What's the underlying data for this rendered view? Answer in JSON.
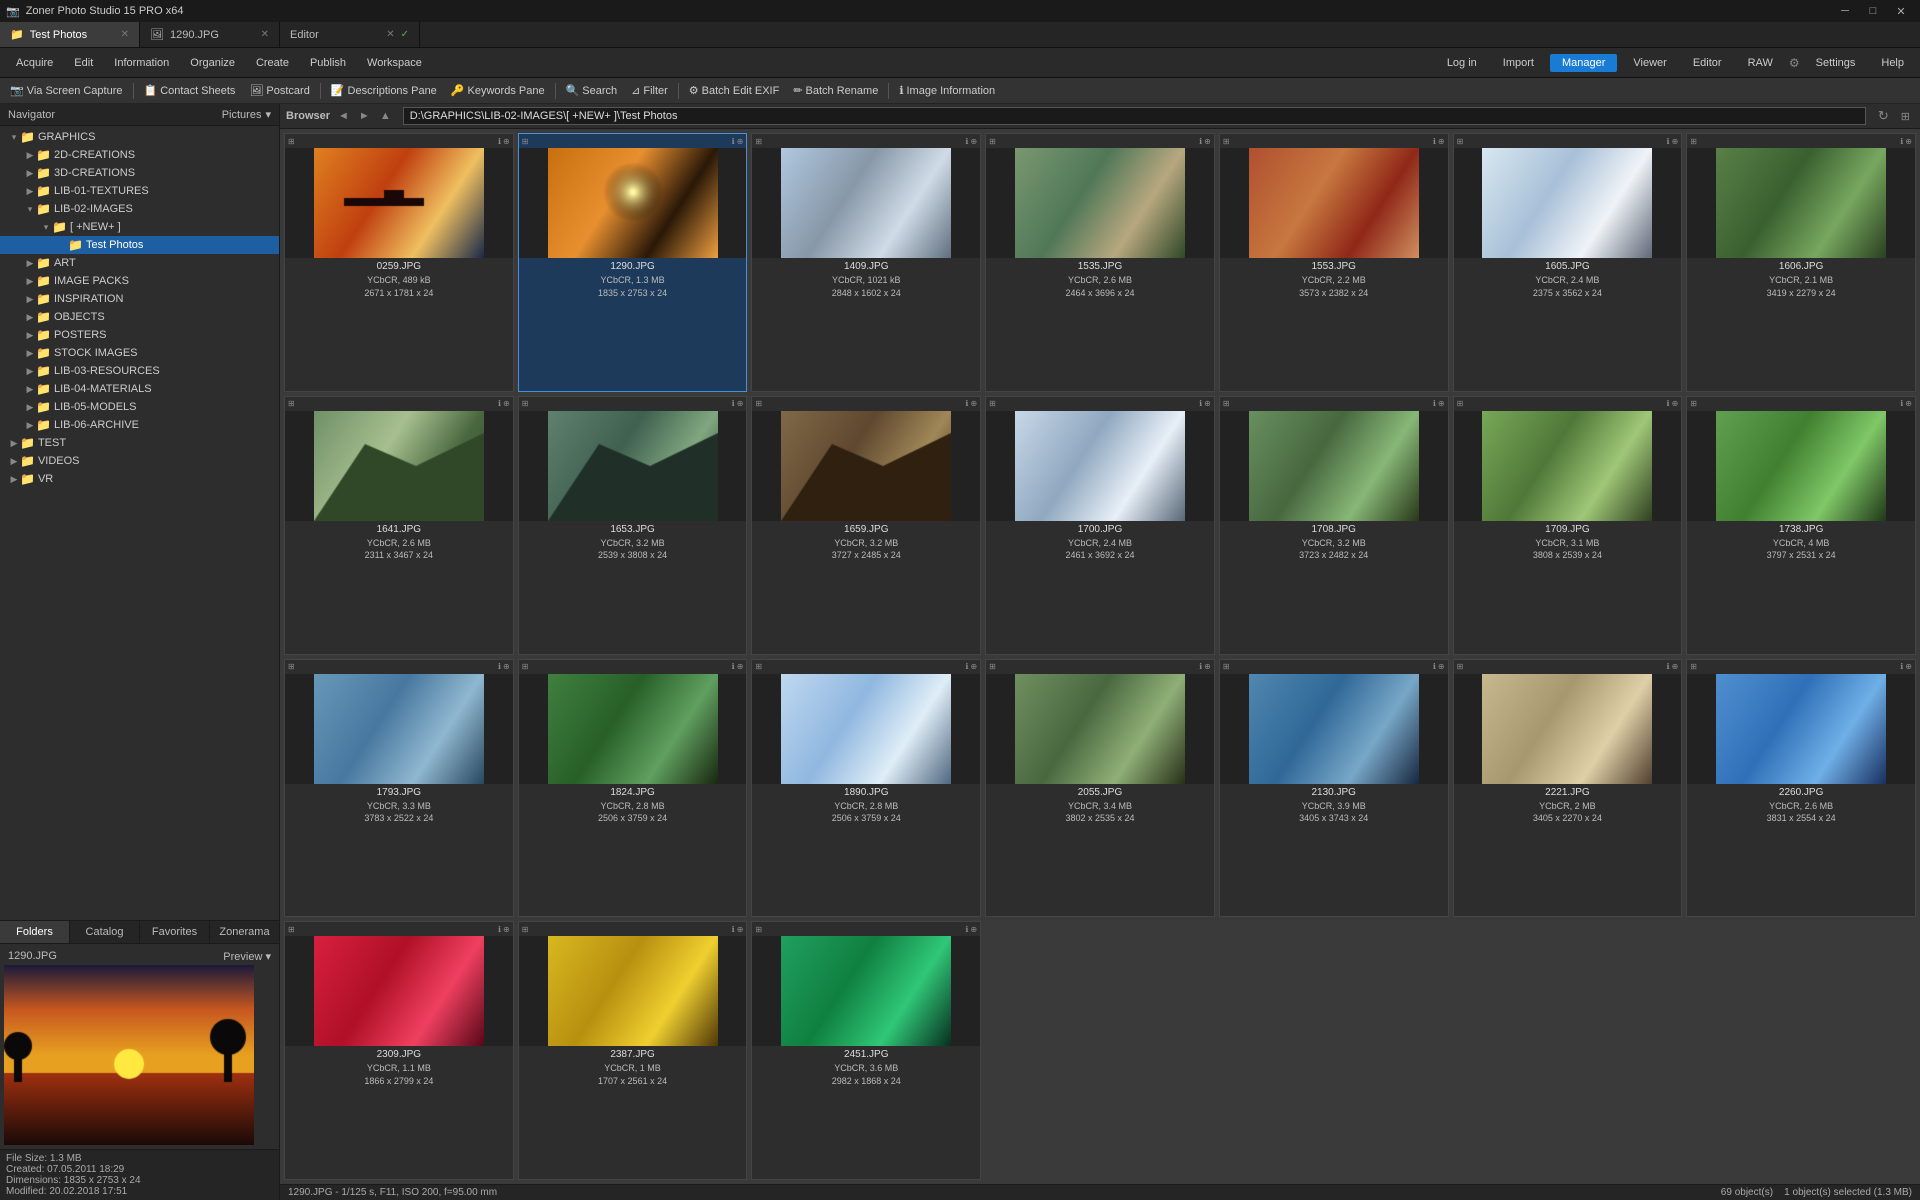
{
  "app": {
    "title": "Zoner Photo Studio 15 PRO x64",
    "icon": "📷"
  },
  "titlebar": {
    "title": "Zoner Photo Studio 15 PRO x64",
    "min": "─",
    "max": "□",
    "close": "✕"
  },
  "tabs": [
    {
      "id": "test-photos",
      "label": "Test Photos",
      "active": true,
      "closable": true
    },
    {
      "id": "1290jpg",
      "label": "1290.JPG",
      "active": false,
      "closable": true
    },
    {
      "id": "editor",
      "label": "Editor",
      "active": false,
      "closable": true
    }
  ],
  "topnav": {
    "items": [
      "Acquire",
      "Edit",
      "Information",
      "Organize",
      "Create",
      "Publish",
      "Workspace"
    ],
    "right": [
      "Log in",
      "Import",
      "Manager",
      "Viewer",
      "Editor",
      "RAW"
    ]
  },
  "toolbar": {
    "items": [
      "Via Screen Capture",
      "Contact Sheets",
      "Postcard",
      "Descriptions Pane",
      "Keywords Pane",
      "Search",
      "Filter",
      "Batch Edit EXIF",
      "Batch Rename",
      "Image Information"
    ]
  },
  "sidebar": {
    "header": {
      "left": "Navigator",
      "right": "Pictures"
    },
    "tree": [
      {
        "level": 0,
        "label": "GRAPHICS",
        "type": "folder",
        "open": true
      },
      {
        "level": 1,
        "label": "2D-CREATIONS",
        "type": "folder",
        "open": false
      },
      {
        "level": 1,
        "label": "3D-CREATIONS",
        "type": "folder",
        "open": false
      },
      {
        "level": 1,
        "label": "LIB-01-TEXTURES",
        "type": "folder",
        "open": false
      },
      {
        "level": 1,
        "label": "LIB-02-IMAGES",
        "type": "folder",
        "open": true
      },
      {
        "level": 2,
        "label": "[ +NEW+ ]",
        "type": "folder",
        "open": true
      },
      {
        "level": 3,
        "label": "Test Photos",
        "type": "folder",
        "open": false,
        "selected": true
      },
      {
        "level": 1,
        "label": "ART",
        "type": "folder",
        "open": false
      },
      {
        "level": 1,
        "label": "IMAGE PACKS",
        "type": "folder",
        "open": false
      },
      {
        "level": 1,
        "label": "INSPIRATION",
        "type": "folder",
        "open": false
      },
      {
        "level": 1,
        "label": "OBJECTS",
        "type": "folder",
        "open": false
      },
      {
        "level": 1,
        "label": "POSTERS",
        "type": "folder",
        "open": false
      },
      {
        "level": 1,
        "label": "STOCK IMAGES",
        "type": "folder",
        "open": false
      },
      {
        "level": 1,
        "label": "LIB-03-RESOURCES",
        "type": "folder",
        "open": false
      },
      {
        "level": 1,
        "label": "LIB-04-MATERIALS",
        "type": "folder",
        "open": false
      },
      {
        "level": 1,
        "label": "LIB-05-MODELS",
        "type": "folder",
        "open": false
      },
      {
        "level": 1,
        "label": "LIB-06-ARCHIVE",
        "type": "folder",
        "open": false
      },
      {
        "level": 0,
        "label": "TEST",
        "type": "folder",
        "open": false
      },
      {
        "level": 0,
        "label": "VIDEOS",
        "type": "folder",
        "open": false
      },
      {
        "level": 0,
        "label": "VR",
        "type": "folder",
        "open": false
      }
    ],
    "tabs": [
      "Folders",
      "Catalog",
      "Favorites",
      "Zonerama"
    ],
    "active_tab": "Folders",
    "preview": {
      "filename": "1290.JPG",
      "label": "Preview"
    }
  },
  "browser": {
    "label": "Browser",
    "path": "D:\\GRAPHICS\\LIB-02-IMAGES\\[ +NEW+ ]\\Test Photos",
    "thumbnails": [
      {
        "filename": "0259.JPG",
        "colorspace": "YCbCR",
        "size": "489 kB",
        "dims": "2671 x 1781 x 24",
        "selected": false,
        "color": "#c4621a"
      },
      {
        "filename": "1290.JPG",
        "colorspace": "YCbCR",
        "size": "1.3 MB",
        "dims": "1835 x 2753 x 24",
        "selected": true,
        "color": "#e8a020"
      },
      {
        "filename": "1409.JPG",
        "colorspace": "YCbCR",
        "size": "1021 kB",
        "dims": "2848 x 1602 x 24",
        "selected": false,
        "color": "#8ab0cc"
      },
      {
        "filename": "1535.JPG",
        "colorspace": "YCbCR",
        "size": "2.6 MB",
        "dims": "2464 x 3696 x 24",
        "selected": false,
        "color": "#7a9060"
      },
      {
        "filename": "1553.JPG",
        "colorspace": "YCbCR",
        "size": "2.2 MB",
        "dims": "3573 x 2382 x 24",
        "selected": false,
        "color": "#b05830"
      },
      {
        "filename": "1605.JPG",
        "colorspace": "YCbCR",
        "size": "2.4 MB",
        "dims": "2375 x 3562 x 24",
        "selected": false,
        "color": "#d0d8e0"
      },
      {
        "filename": "1606.JPG",
        "colorspace": "YCbCR",
        "size": "2.1 MB",
        "dims": "3419 x 2279 x 24",
        "selected": false,
        "color": "#6888a0"
      },
      {
        "filename": "1641.JPG",
        "colorspace": "YCbCR",
        "size": "2.6 MB",
        "dims": "2311 x 3467 x 24",
        "selected": false,
        "color": "#5a7050"
      },
      {
        "filename": "1653.JPG",
        "colorspace": "YCbCR",
        "size": "3.2 MB",
        "dims": "2539 x 3808 x 24",
        "selected": false,
        "color": "#708860"
      },
      {
        "filename": "1659.JPG",
        "colorspace": "YCbCR",
        "size": "3.2 MB",
        "dims": "3727 x 2485 x 24",
        "selected": false,
        "color": "#607868"
      },
      {
        "filename": "1700.JPG",
        "colorspace": "YCbCR",
        "size": "2.4 MB",
        "dims": "2461 x 3692 x 24",
        "selected": false,
        "color": "#9ab0c0"
      },
      {
        "filename": "1708.JPG",
        "colorspace": "YCbCR",
        "size": "3.2 MB",
        "dims": "3723 x 2482 x 24",
        "selected": false,
        "color": "#88a070"
      },
      {
        "filename": "1709.JPG",
        "colorspace": "YCbCR",
        "size": "3.1 MB",
        "dims": "3808 x 2539 x 24",
        "selected": false,
        "color": "#78a858"
      },
      {
        "filename": "1738.JPG",
        "colorspace": "YCbCR",
        "size": "4 MB",
        "dims": "3797 x 2531 x 24",
        "selected": false,
        "color": "#60a060"
      },
      {
        "filename": "1793.JPG",
        "colorspace": "YCbCR",
        "size": "3.3 MB",
        "dims": "3783 x 2522 x 24",
        "selected": false,
        "color": "#7898b0"
      },
      {
        "filename": "1824.JPG",
        "colorspace": "YCbCR",
        "size": "2.8 MB",
        "dims": "2506 x 3759 x 24",
        "selected": false,
        "color": "#508050"
      },
      {
        "filename": "1890.JPG",
        "colorspace": "YCbCR",
        "size": "2.8 MB",
        "dims": "2506 x 3759 x 24",
        "selected": false,
        "color": "#c0d8e8"
      },
      {
        "filename": "2055.JPG",
        "colorspace": "YCbCR",
        "size": "3.4 MB",
        "dims": "3802 x 2535 x 24",
        "selected": false,
        "color": "#609070"
      },
      {
        "filename": "2130.JPG",
        "colorspace": "YCbCR",
        "size": "3.9 MB",
        "dims": "3405 x 3743 x 24",
        "selected": false,
        "color": "#5080a0"
      },
      {
        "filename": "2221.JPG",
        "colorspace": "YCbCR",
        "size": "2 MB",
        "dims": "3405 x 2270 x 24",
        "selected": false,
        "color": "#c8b890"
      },
      {
        "filename": "2260.JPG",
        "colorspace": "YCbCR",
        "size": "2.6 MB",
        "dims": "3831 x 2554 x 24",
        "selected": false,
        "color": "#4888c8"
      },
      {
        "filename": "2309.JPG",
        "colorspace": "YCbCR",
        "size": "1.1 MB",
        "dims": "1866 x 2799 x 24",
        "selected": false,
        "color": "#e03060"
      },
      {
        "filename": "2387.JPG",
        "colorspace": "YCbCR",
        "size": "1 MB",
        "dims": "1707 x 2561 x 24",
        "selected": false,
        "color": "#e8c840"
      },
      {
        "filename": "2451.JPG",
        "colorspace": "YCbCR",
        "size": "3.6 MB",
        "dims": "2982 x 1868 x 24",
        "selected": false,
        "color": "#208040"
      }
    ]
  },
  "statusbar": {
    "filesize": "File Size: 1.3 MB",
    "created": "Created: 07.05.2011 18:29",
    "dimensions": "Dimensions: 1835 x 2753 x 24",
    "modified": "Modified: 20.02.2018 17:51",
    "caption": "1290.JPG - 1/125 s, F11, ISO 200, f=95.00 mm",
    "right": "69 object(s)",
    "selection": "1 object(s) selected (1.3 MB)"
  },
  "colors": {
    "selected_blue": "#1a7bd4",
    "bg_dark": "#2d2d2d",
    "bg_darker": "#1a1a1a",
    "text_light": "#ccc",
    "accent": "#4a90d9"
  }
}
